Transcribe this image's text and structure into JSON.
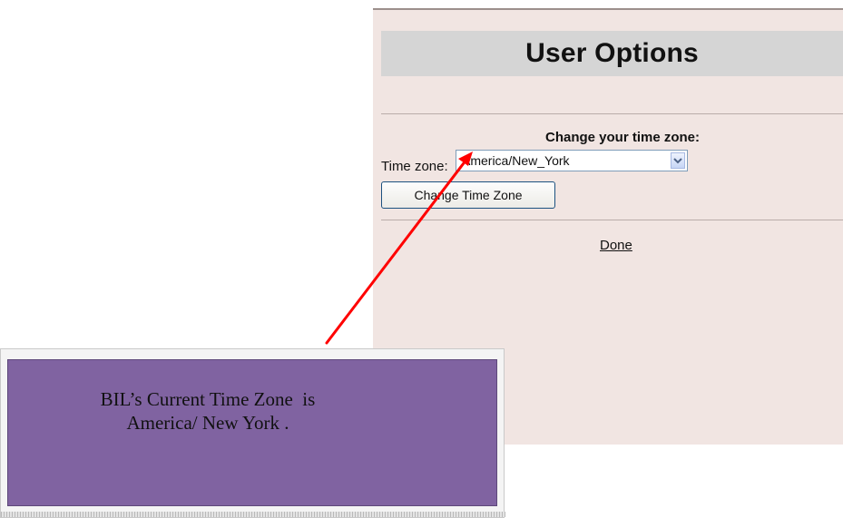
{
  "panel": {
    "title": "User Options",
    "section_heading": "Change your time zone:",
    "timezone_label": "Time zone:",
    "timezone_value": "America/New_York",
    "change_button_label": "Change Time Zone",
    "done_link": "Done"
  },
  "callout": {
    "line1": "BIL’s Current Time Zone  is",
    "line2": "America/ New York ."
  },
  "icons": {
    "dropdown": "chevron-down-icon",
    "annotation_arrow": "arrow-icon"
  },
  "colors": {
    "panel_bg": "#f1e5e2",
    "title_bar_bg": "#d5d5d5",
    "callout_bg": "#8063a1",
    "arrow": "#ff0000"
  }
}
